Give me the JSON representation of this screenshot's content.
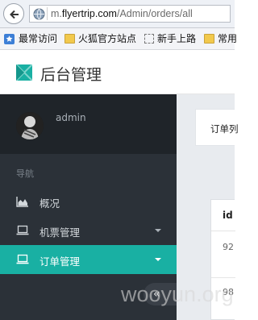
{
  "browser": {
    "url_prefix": "m.",
    "url_host": "flyertrip.com",
    "url_path": "/Admin/orders/all"
  },
  "bookmarks": [
    {
      "label": "最常访问",
      "icon": "bookmark-star-icon"
    },
    {
      "label": "火狐官方站点",
      "icon": "folder-icon"
    },
    {
      "label": "新手上路",
      "icon": "page-dotted-icon"
    },
    {
      "label": "常用",
      "icon": "folder-icon"
    }
  ],
  "app": {
    "title": "后台管理"
  },
  "user": {
    "name": "admin"
  },
  "sidebar": {
    "section_label": "导航",
    "items": [
      {
        "label": "概况",
        "icon": "chart-area-icon",
        "active": false,
        "has_caret": false
      },
      {
        "label": "机票管理",
        "icon": "laptop-icon",
        "active": false,
        "has_caret": true
      },
      {
        "label": "订单管理",
        "icon": "laptop-icon",
        "active": true,
        "has_caret": true
      }
    ],
    "collapse_label": "«"
  },
  "main": {
    "card_title": "订单列",
    "table": {
      "header": "id",
      "rows": [
        "92",
        "98"
      ]
    }
  },
  "watermark": "wooyun.org",
  "colors": {
    "sidebar_bg": "#2b3138",
    "active": "#19b0a3",
    "logo": "#19b0a3"
  }
}
